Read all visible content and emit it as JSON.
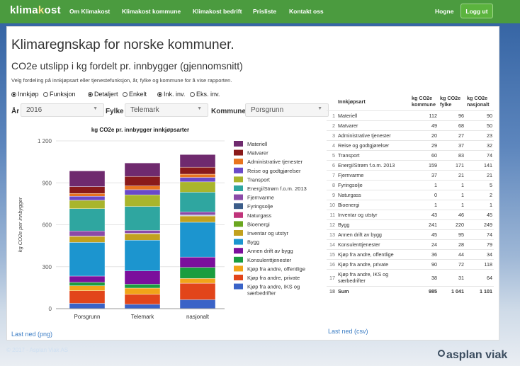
{
  "nav": {
    "brand_a": "klima",
    "brand_b": "k",
    "brand_c": "ost",
    "items": [
      "Om Klimakost",
      "Klimakost kommune",
      "Klimakost bedrift",
      "Prisliste",
      "Kontakt oss"
    ],
    "home": "Hogne",
    "login": "Logg ut"
  },
  "page": {
    "title": "Klimaregnskap for norske kommuner.",
    "subtitle": "CO2e utslipp i kg fordelt pr. innbygger (gjennomsnitt)",
    "help": "Velg fordeling på innkjøpsart eller tjenestefunksjon, år, fylke og kommune for å vise rapporten."
  },
  "radios": [
    {
      "label": "Innkjøp",
      "checked": true
    },
    {
      "label": "Funksjon",
      "checked": false
    },
    {
      "label": "Detaljert",
      "checked": true
    },
    {
      "label": "Enkelt",
      "checked": false
    },
    {
      "label": "Ink. inv.",
      "checked": true
    },
    {
      "label": "Eks. inv.",
      "checked": false
    }
  ],
  "filters": {
    "year_label": "År",
    "year": "2016",
    "county_label": "Fylke",
    "county": "Telemark",
    "muni_label": "Kommune",
    "muni": "Porsgrunn"
  },
  "colors": {
    "navbar": "#4b9b3f",
    "link": "#3a7cc4"
  },
  "chart_data": {
    "type": "bar",
    "stacked": true,
    "title": "kg CO2e pr. innbygger innkjøpsarter",
    "ylabel": "kg CO2e per innbygger",
    "xlabel": "",
    "ylim": [
      0,
      1200
    ],
    "yticks": [
      "0",
      "300",
      "600",
      "900",
      "1 200"
    ],
    "categories": [
      "Porsgrunn",
      "Telemark",
      "nasjonalt"
    ],
    "legend_position": "right",
    "series": [
      {
        "name": "Materiell",
        "color": "#6f2a6e",
        "values": [
          112,
          96,
          90
        ]
      },
      {
        "name": "Matvarer",
        "color": "#8a1a1a",
        "values": [
          49,
          68,
          50
        ]
      },
      {
        "name": "Administrative tjenester",
        "color": "#e8741f",
        "values": [
          20,
          27,
          23
        ]
      },
      {
        "name": "Reise og godtgjørelser",
        "color": "#6a49c9",
        "values": [
          29,
          37,
          32
        ]
      },
      {
        "name": "Transport",
        "color": "#a9b52c",
        "values": [
          60,
          83,
          74
        ]
      },
      {
        "name": "Energi/Strøm f.o.m. 2013",
        "color": "#2fa6a0",
        "values": [
          159,
          171,
          141
        ]
      },
      {
        "name": "Fjernvarme",
        "color": "#8b4aa8",
        "values": [
          37,
          21,
          21
        ]
      },
      {
        "name": "Fyringsolje",
        "color": "#3c5d8a",
        "values": [
          1,
          1,
          5
        ]
      },
      {
        "name": "Naturgass",
        "color": "#c0347a",
        "values": [
          0,
          1,
          2
        ]
      },
      {
        "name": "Bioenergi",
        "color": "#6aa61f",
        "values": [
          1,
          1,
          1
        ]
      },
      {
        "name": "Inventar og utstyr",
        "color": "#c2a11e",
        "values": [
          43,
          46,
          45
        ]
      },
      {
        "name": "Bygg",
        "color": "#1c95cf",
        "values": [
          241,
          220,
          249
        ]
      },
      {
        "name": "Annen drift av bygg",
        "color": "#7b0f9c",
        "values": [
          45,
          95,
          74
        ]
      },
      {
        "name": "Konsulenttjenester",
        "color": "#1a9d3f",
        "values": [
          24,
          28,
          79
        ]
      },
      {
        "name": "Kjøp fra andre, offentlige",
        "color": "#f1a419",
        "values": [
          36,
          44,
          34
        ]
      },
      {
        "name": "Kjøp fra andre, private",
        "color": "#e2451a",
        "values": [
          90,
          72,
          118
        ]
      },
      {
        "name": "Kjøp fra andre, IKS og særbedrifter",
        "color": "#3a63c7",
        "values": [
          38,
          31,
          64
        ]
      }
    ]
  },
  "table": {
    "headers": [
      "Innkjøpsart",
      "kg CO2e kommune",
      "kg CO2e fylke",
      "kg CO2e nasjonalt"
    ],
    "rows": [
      {
        "i": "1",
        "name": "Materiell",
        "k": "112",
        "f": "96",
        "n": "90"
      },
      {
        "i": "2",
        "name": "Matvarer",
        "k": "49",
        "f": "68",
        "n": "50"
      },
      {
        "i": "3",
        "name": "Administrative tjenester",
        "k": "20",
        "f": "27",
        "n": "23"
      },
      {
        "i": "4",
        "name": "Reise og godtgjørelser",
        "k": "29",
        "f": "37",
        "n": "32"
      },
      {
        "i": "5",
        "name": "Transport",
        "k": "60",
        "f": "83",
        "n": "74"
      },
      {
        "i": "6",
        "name": "Energi/Strøm f.o.m. 2013",
        "k": "159",
        "f": "171",
        "n": "141"
      },
      {
        "i": "7",
        "name": "Fjernvarme",
        "k": "37",
        "f": "21",
        "n": "21"
      },
      {
        "i": "8",
        "name": "Fyringsolje",
        "k": "1",
        "f": "1",
        "n": "5"
      },
      {
        "i": "9",
        "name": "Naturgass",
        "k": "0",
        "f": "1",
        "n": "2"
      },
      {
        "i": "10",
        "name": "Bioenergi",
        "k": "1",
        "f": "1",
        "n": "1"
      },
      {
        "i": "11",
        "name": "Inventar og utstyr",
        "k": "43",
        "f": "46",
        "n": "45"
      },
      {
        "i": "12",
        "name": "Bygg",
        "k": "241",
        "f": "220",
        "n": "249"
      },
      {
        "i": "13",
        "name": "Annen drift av bygg",
        "k": "45",
        "f": "95",
        "n": "74"
      },
      {
        "i": "14",
        "name": "Konsulenttjenester",
        "k": "24",
        "f": "28",
        "n": "79"
      },
      {
        "i": "15",
        "name": "Kjøp fra andre, offentlige",
        "k": "36",
        "f": "44",
        "n": "34"
      },
      {
        "i": "16",
        "name": "Kjøp fra andre, private",
        "k": "90",
        "f": "72",
        "n": "118"
      },
      {
        "i": "17",
        "name": "Kjøp fra andre, IKS og særbedrifter",
        "k": "38",
        "f": "31",
        "n": "64"
      },
      {
        "i": "18",
        "name": "Sum",
        "k": "985",
        "f": "1 041",
        "n": "1 101"
      }
    ]
  },
  "links": {
    "png": "Last ned (png)",
    "csv": "Last ned (csv)"
  },
  "footer": {
    "copyright": "© 2017 - Asplan Viak AS",
    "logo": "asplan viak"
  }
}
